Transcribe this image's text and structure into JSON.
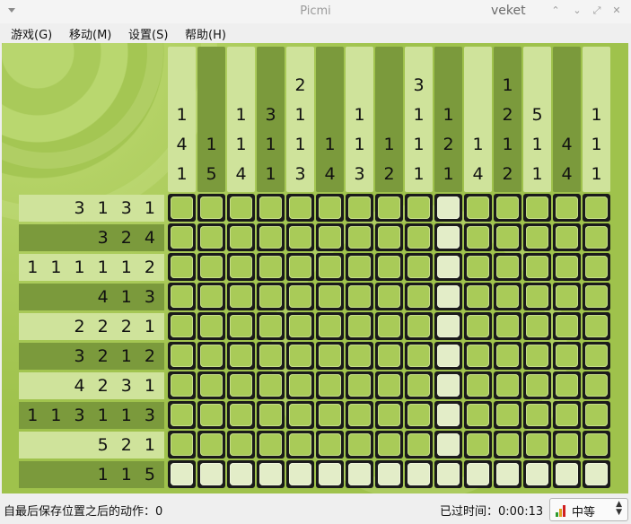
{
  "window": {
    "title": "Picmi",
    "user": "veket"
  },
  "window_controls": [
    {
      "name": "minimize-icon",
      "glyph": "⌃"
    },
    {
      "name": "restore-icon",
      "glyph": "⌄"
    },
    {
      "name": "maximize-icon",
      "glyph": "⤢"
    },
    {
      "name": "close-icon",
      "glyph": "✕"
    }
  ],
  "menu": [
    {
      "label": "游戏(G)"
    },
    {
      "label": "移动(M)"
    },
    {
      "label": "设置(S)"
    },
    {
      "label": "帮助(H)"
    }
  ],
  "puzzle": {
    "columns": 15,
    "rows": 10,
    "column_clues": [
      [
        "1",
        "4",
        "1"
      ],
      [
        "1",
        "5"
      ],
      [
        "1",
        "1",
        "4"
      ],
      [
        "3",
        "1",
        "1"
      ],
      [
        "2",
        "1",
        "1",
        "3"
      ],
      [
        "1",
        "4"
      ],
      [
        "1",
        "1",
        "3"
      ],
      [
        "1",
        "2"
      ],
      [
        "3",
        "1",
        "1",
        "1"
      ],
      [
        "1",
        "2",
        "1"
      ],
      [
        "1",
        "4"
      ],
      [
        "1",
        "2",
        "1",
        "2"
      ],
      [
        "5",
        "1",
        "1"
      ],
      [
        "4",
        "4"
      ],
      [
        "1",
        "1",
        "1"
      ]
    ],
    "row_clues": [
      "3 1 3 1",
      "3 2 4",
      "1 1 1 1 1 2",
      "4 1 3",
      "2 2 2 1",
      "3 2 1 2",
      "4 2 3 1",
      "1 1 3 1 1 3",
      "5 2 1",
      "1 1 5"
    ],
    "highlighted_column": 10,
    "highlighted_row": 10
  },
  "status": {
    "actions_label": "自最后保存位置之后的动作：0",
    "elapsed_label": "已过时间：0:00:13",
    "difficulty": "中等",
    "difficulty_colors": [
      "#2e9a2e",
      "#e0a020",
      "#d02020"
    ]
  }
}
